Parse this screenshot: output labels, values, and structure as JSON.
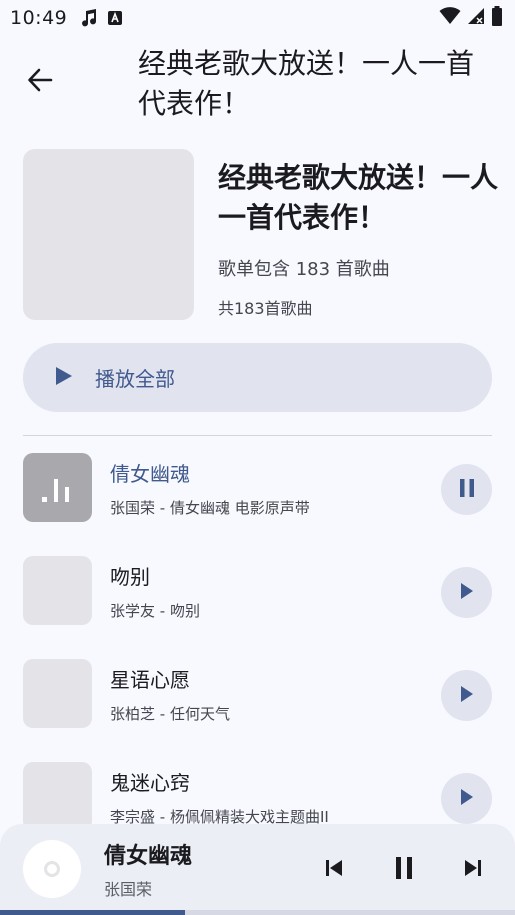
{
  "status_bar": {
    "time": "10:49",
    "icons": [
      "music-note-icon",
      "font-a-icon",
      "wifi-icon",
      "signal-icon",
      "battery-icon"
    ]
  },
  "header": {
    "back_icon": "arrow-back-icon",
    "title": "经典老歌大放送！一人一首代表作！"
  },
  "playlist": {
    "title": "经典老歌大放送！一人一首代表作！",
    "description": "歌单包含 183 首歌曲",
    "count": "共183首歌曲",
    "play_all_label": "播放全部"
  },
  "songs": [
    {
      "title": "倩女幽魂",
      "subtitle": "张国荣 - 倩女幽魂 电影原声带",
      "playing": true,
      "action_icon": "pause-icon"
    },
    {
      "title": "吻别",
      "subtitle": "张学友 - 吻别",
      "playing": false,
      "action_icon": "play-icon"
    },
    {
      "title": "星语心愿",
      "subtitle": "张柏芝 - 任何天气",
      "playing": false,
      "action_icon": "play-icon"
    },
    {
      "title": "鬼迷心窍",
      "subtitle": "李宗盛 - 杨佩佩精装大戏主题曲II",
      "playing": false,
      "action_icon": "play-icon"
    }
  ],
  "mini_player": {
    "title": "倩女幽魂",
    "artist": "张国荣",
    "progress": 0.36
  },
  "colors": {
    "accent": "#415a8e",
    "background": "#f8f9ff",
    "tonal_container": "#e1e3ee"
  }
}
